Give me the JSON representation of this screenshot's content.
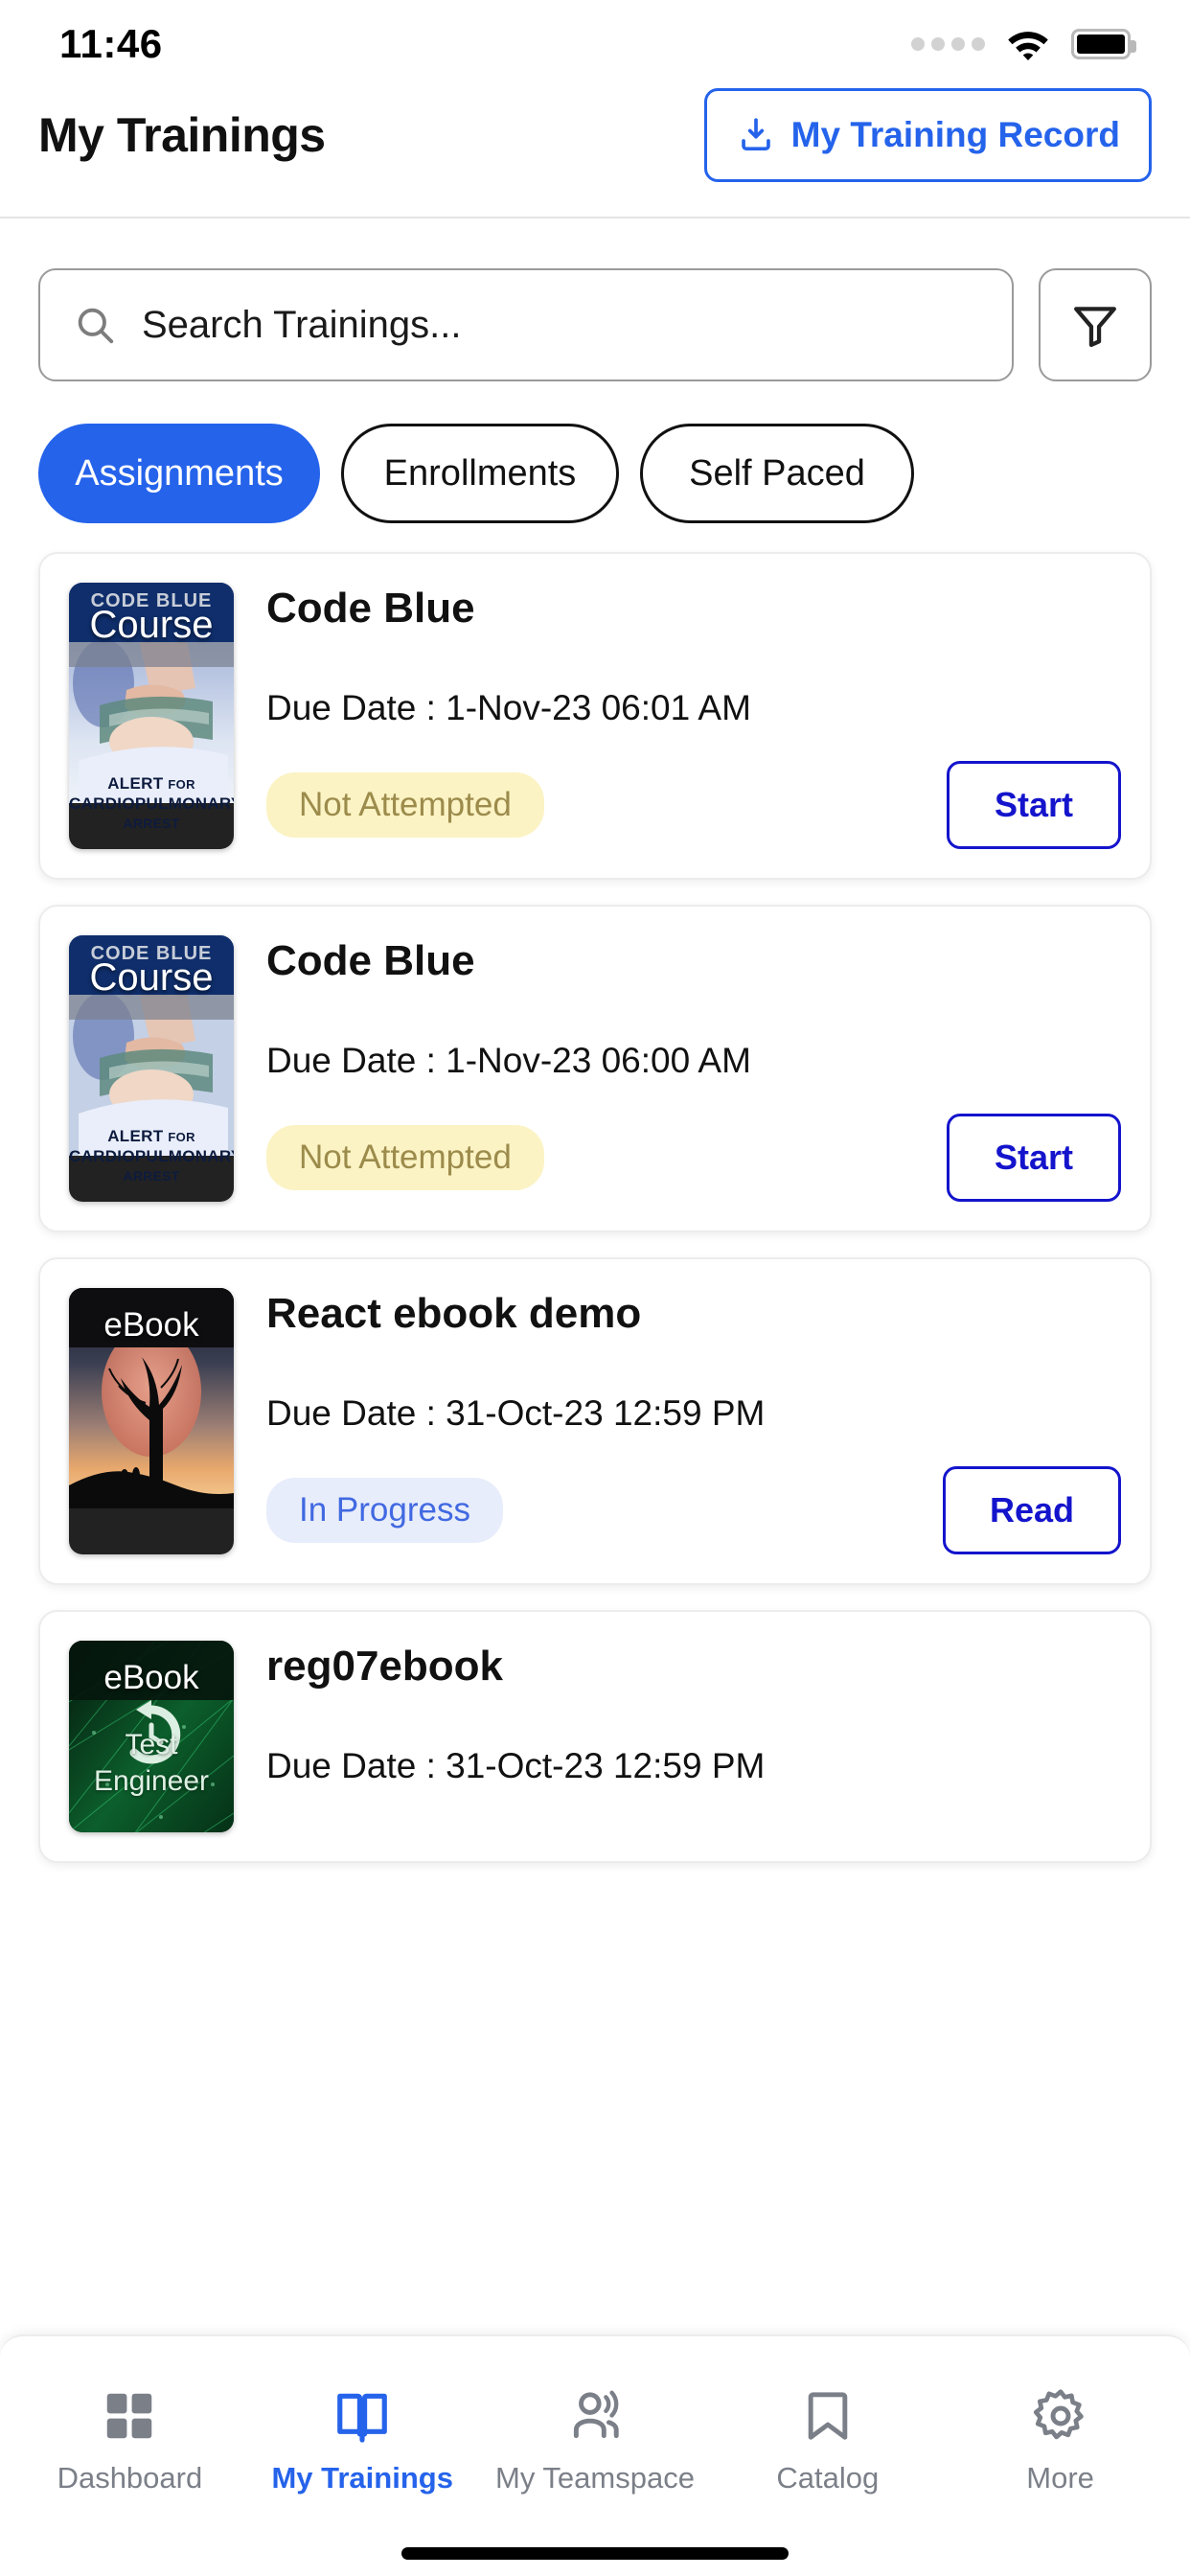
{
  "status_bar": {
    "time": "11:46",
    "signal_icon": "signal-dots-icon",
    "wifi_icon": "wifi-icon",
    "battery_icon": "battery-full-icon"
  },
  "header": {
    "title": "My Trainings",
    "record_button": {
      "label": "My Training Record",
      "icon": "download-icon",
      "color": "#2563eb"
    }
  },
  "search": {
    "placeholder": "Search Trainings...",
    "icon": "search-icon",
    "filter_icon": "filter-funnel-icon"
  },
  "tabs": {
    "active": "Assignments",
    "items": [
      {
        "label": "Assignments",
        "active": true
      },
      {
        "label": "Enrollments",
        "active": false
      },
      {
        "label": "Self Paced",
        "active": false
      }
    ],
    "active_color": "#2563eb"
  },
  "trainings": [
    {
      "title": "Code Blue",
      "kind": "Course",
      "due_label": "Due Date : 1-Nov-23 06:01 AM",
      "status": "Not Attempted",
      "status_style": "not",
      "action": "Start",
      "thumb": {
        "brand": "CODE BLUE",
        "footer": "ALERT FOR\nCARDIOPULMONARY\nARREST",
        "theme": "cpr"
      }
    },
    {
      "title": "Code Blue",
      "kind": "Course",
      "due_label": "Due Date : 1-Nov-23 06:00 AM",
      "status": "Not Attempted",
      "status_style": "not",
      "action": "Start",
      "thumb": {
        "brand": "CODE BLUE",
        "footer": "ALERT FOR\nCARDIOPULMONARY\nARREST",
        "theme": "cpr"
      }
    },
    {
      "title": "React ebook demo",
      "kind": "eBook",
      "due_label": "Due Date : 31-Oct-23 12:59 PM",
      "status": "In Progress",
      "status_style": "prog",
      "action": "Read",
      "thumb": {
        "brand": "",
        "footer": "",
        "theme": "sunset-tree"
      }
    },
    {
      "title": "reg07ebook",
      "kind": "eBook",
      "due_label": "Due Date : 31-Oct-23 12:59 PM",
      "status": "",
      "status_style": "",
      "action": "",
      "thumb": {
        "brand": "",
        "footer": "Test\nEngineer",
        "theme": "green-tech"
      }
    }
  ],
  "bottom_nav": {
    "active": "My Trainings",
    "items": [
      {
        "label": "Dashboard",
        "icon": "grid-icon",
        "active": false
      },
      {
        "label": "My Trainings",
        "icon": "book-icon",
        "active": true
      },
      {
        "label": "My Teamspace",
        "icon": "people-icon",
        "active": false
      },
      {
        "label": "Catalog",
        "icon": "bookmark-icon",
        "active": false
      },
      {
        "label": "More",
        "icon": "gear-icon",
        "active": false
      }
    ],
    "active_color": "#2563eb",
    "inactive_color": "#7b7f88"
  }
}
